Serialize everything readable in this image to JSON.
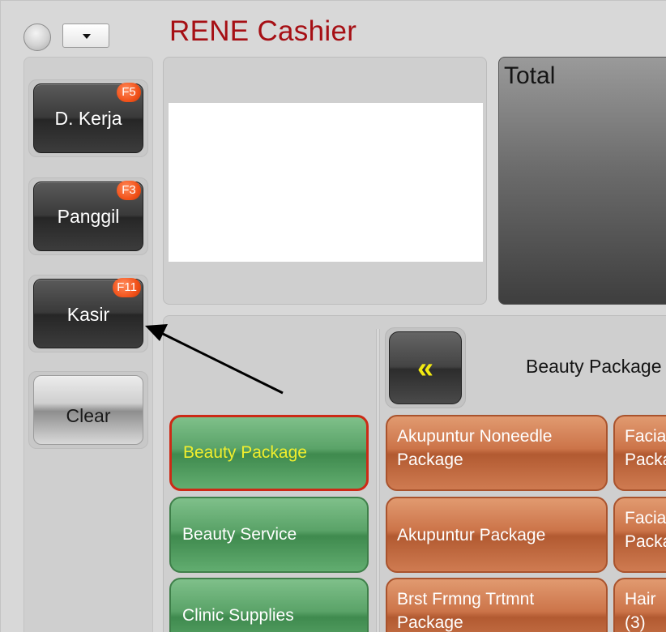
{
  "window": {
    "title": "RENE Cashier"
  },
  "sidebar": {
    "buttons": [
      {
        "label": "D. Kerja",
        "shortcut": "F5"
      },
      {
        "label": "Panggil",
        "shortcut": "F3"
      },
      {
        "label": "Kasir",
        "shortcut": "F11"
      },
      {
        "label": "Clear"
      }
    ]
  },
  "total": {
    "label": "Total"
  },
  "products": {
    "back_glyph": "«",
    "category_title": "Beauty Package",
    "categories": [
      {
        "label": "Beauty Package",
        "selected": true
      },
      {
        "label": "Beauty Service"
      },
      {
        "label": "Clinic Supplies"
      }
    ],
    "items": [
      {
        "label": "Akupuntur Noneedle Package"
      },
      {
        "label": "Facial Package"
      },
      {
        "label": "Akupuntur Package"
      },
      {
        "label": "Facial Package"
      },
      {
        "label": "Brst Frmng Trtmnt Package"
      },
      {
        "label": "Hair (3)"
      }
    ]
  },
  "colors": {
    "title_red": "#a60f14",
    "badge_orange": "#f2521a",
    "category_green": "#5aa368",
    "item_orange": "#cc7449",
    "selected_border": "#cc2a16",
    "nav_yellow": "#f2ea12"
  }
}
